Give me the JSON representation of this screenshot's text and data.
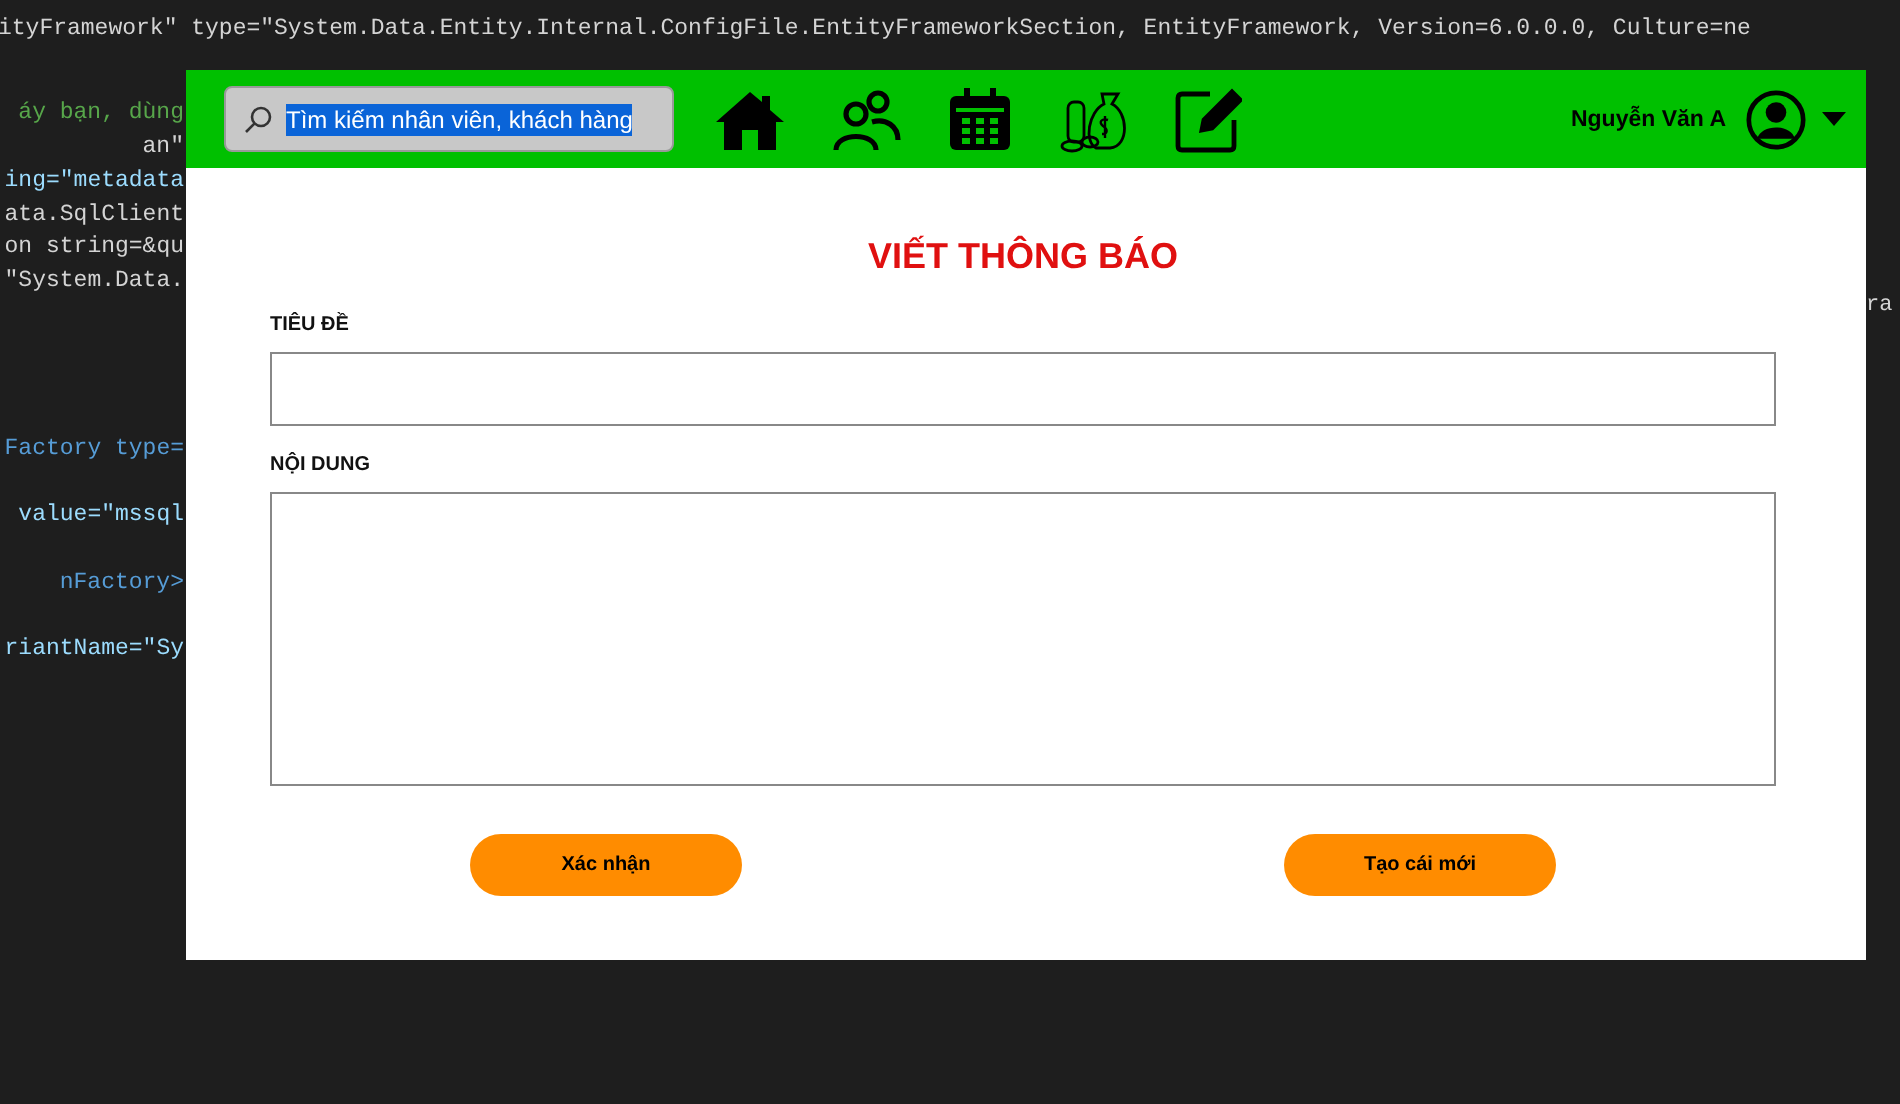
{
  "editor": {
    "top_line": "ityFramework\" type=\"System.Data.Entity.Internal.ConfigFile.EntityFrameworkSection, EntityFramework, Version=6.0.0.0, Culture=ne",
    "left_lines": [
      {
        "text": "áy bạn, dùng",
        "kind": "comment"
      },
      {
        "text": "an\"",
        "kind": "string"
      },
      {
        "text": "ing=\"metadata",
        "kind": "attr"
      },
      {
        "text": "ata.SqlClient",
        "kind": "string"
      },
      {
        "text": "on string=&qu",
        "kind": "string"
      },
      {
        "text": "\"System.Data.",
        "kind": "string"
      },
      {
        "text": "Factory type=",
        "kind": "tag"
      },
      {
        "text": " value=\"mssql",
        "kind": "attr"
      },
      {
        "text": "nFactory>",
        "kind": "tag"
      },
      {
        "text": "riantName=\"Sy",
        "kind": "attr"
      }
    ],
    "right_lines": [
      {
        "text": "ra"
      }
    ]
  },
  "app": {
    "search": {
      "value": "Tìm kiếm nhân viên, khách hàng",
      "text_selected": true
    },
    "nav_icons": [
      {
        "kind": "home"
      },
      {
        "kind": "people"
      },
      {
        "kind": "calendar"
      },
      {
        "kind": "money"
      },
      {
        "kind": "edit"
      }
    ],
    "user": {
      "name": "Nguyễn Văn A"
    },
    "form": {
      "title": "VIẾT THÔNG BÁO",
      "fields": [
        {
          "label": "TIÊU ĐỀ",
          "kind": "line"
        },
        {
          "label": "NỘI DUNG",
          "kind": "area"
        }
      ],
      "buttons": [
        "Xác nhận",
        "Tạo cái mới"
      ]
    }
  }
}
